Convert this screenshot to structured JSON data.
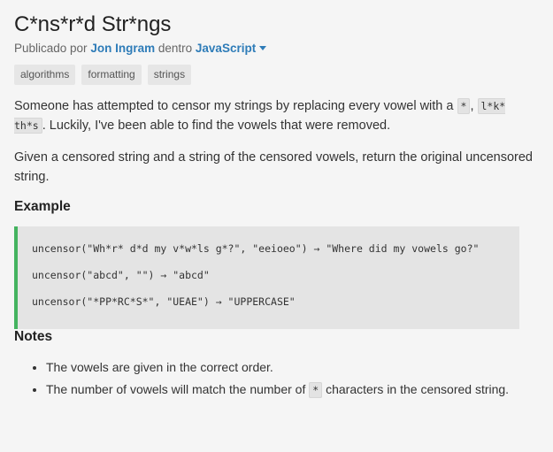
{
  "title": "C*ns*r*d Str*ngs",
  "byline": {
    "prefix": "Publicado por",
    "author": "Jon Ingram",
    "middle": "dentro",
    "language": "JavaScript"
  },
  "tags": [
    "algorithms",
    "formatting",
    "strings"
  ],
  "description": {
    "p1_a": "Someone has attempted to censor my strings by replacing every vowel with a",
    "p1_code1": "*",
    "p1_comma": ",",
    "p1_code2": "l*k* th*s",
    "p1_b": ". Luckily, I've been able to find the vowels that were removed.",
    "p2": "Given a censored string and a string of the censored vowels, return the original uncensored string."
  },
  "example": {
    "heading": "Example",
    "lines": [
      "uncensor(\"Wh*r* d*d my v*w*ls g*?\", \"eeioeo\") → \"Where did my vowels go?\"",
      "uncensor(\"abcd\", \"\") → \"abcd\"",
      "uncensor(\"*PP*RC*S*\", \"UEAE\") → \"UPPERCASE\""
    ]
  },
  "notes": {
    "heading": "Notes",
    "item1": "The vowels are given in the correct order.",
    "item2_a": "The number of vowels will match the number of",
    "item2_code": "*",
    "item2_b": "characters in the censored string."
  },
  "colors": {
    "accent_link": "#2e7cb8",
    "example_border": "#44b35f"
  }
}
